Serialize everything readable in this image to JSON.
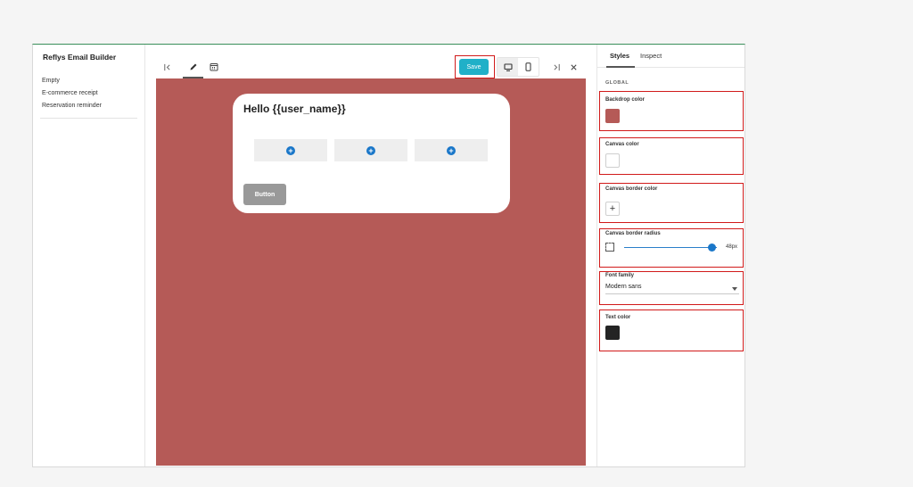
{
  "sidebar": {
    "title": "Reflys Email Builder",
    "items": [
      {
        "label": "Empty"
      },
      {
        "label": "E-commerce receipt"
      },
      {
        "label": "Reservation reminder"
      }
    ]
  },
  "toolbar": {
    "save_label": "Save",
    "icons": [
      "collapse-left-icon",
      "edit-pencil-icon",
      "preview-calendar-icon",
      "desktop-icon",
      "mobile-icon",
      "collapse-right-icon",
      "close-icon"
    ]
  },
  "email": {
    "heading": "Hello {{user_name}}",
    "button_label": "Button",
    "column_count": 3
  },
  "panel": {
    "tabs": [
      {
        "label": "Styles"
      },
      {
        "label": "Inspect"
      }
    ],
    "group_label": "GLOBAL",
    "backdrop": {
      "label": "Backdrop color",
      "value": "#b55a57"
    },
    "canvas": {
      "label": "Canvas color",
      "value": "#ffffff"
    },
    "border_color": {
      "label": "Canvas border color"
    },
    "border_radius": {
      "label": "Canvas border radius",
      "value": "48px",
      "fraction": 0.95
    },
    "font_family": {
      "label": "Font family",
      "value": "Modern sans"
    },
    "text_color": {
      "label": "Text color",
      "value": "#242424"
    }
  },
  "colors": {
    "accent": "#20b0c8",
    "highlight": "#d11a1a",
    "add_dot": "#1a77c9"
  }
}
